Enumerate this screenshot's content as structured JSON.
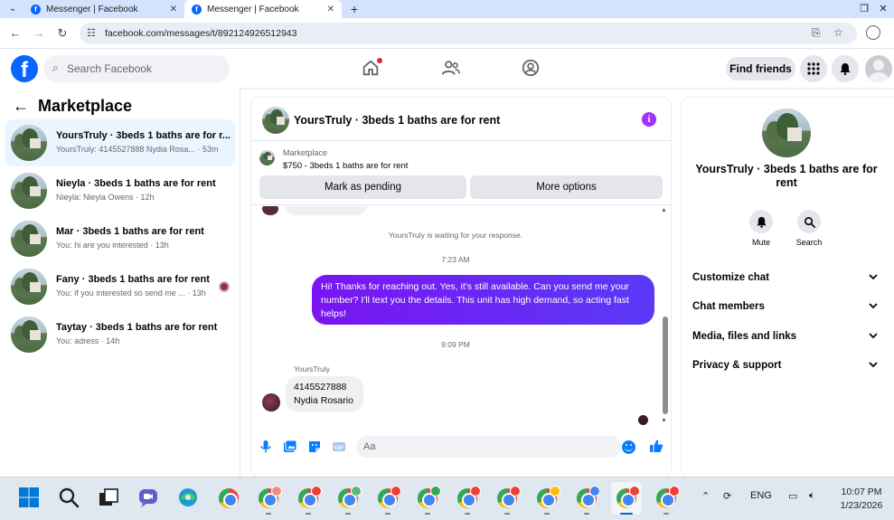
{
  "browser": {
    "tabs": [
      {
        "title": "Messenger | Facebook",
        "active": false
      },
      {
        "title": "Messenger | Facebook",
        "active": true
      }
    ],
    "url": "facebook.com/messages/t/892124926512943"
  },
  "header": {
    "search_placeholder": "Search Facebook",
    "find_friends_label": "Find friends"
  },
  "sidebar": {
    "title": "Marketplace",
    "conversations": [
      {
        "title": "YoursTruly · 3beds 1 baths are for r...",
        "preview": "YoursTruly: 4145527888 Nydia Rosa...",
        "time": "· 53m",
        "active": true
      },
      {
        "title": "Nieyla · 3beds 1 baths are for rent",
        "preview": "Nieyla: Nieyla Owens",
        "time": "· 12h",
        "active": false
      },
      {
        "title": "Mar · 3beds 1 baths are for rent",
        "preview": "You: hi are you interested",
        "time": "· 13h",
        "active": false
      },
      {
        "title": "Fany · 3beds 1 baths are for rent",
        "preview": "You: if you interested so send me ...",
        "time": "· 13h",
        "active": false
      },
      {
        "title": "Taytay · 3beds 1 baths are for rent",
        "preview": "You: adress",
        "time": "· 14h",
        "active": false
      }
    ]
  },
  "chat": {
    "title": "YoursTruly · 3beds 1 baths are for rent",
    "marketplace_label": "Marketplace",
    "listing": "$750 - 3beds 1 baths are for rent",
    "mark_pending_label": "Mark as pending",
    "more_options_label": "More options",
    "waiting_text": "YoursTruly is waiting for your response.",
    "time_1": "7:23 AM",
    "outgoing_message": "Hi! Thanks for reaching out. Yes, it's still available. Can you send me your number? I'll text you the details. This unit has high demand, so acting fast helps!",
    "time_2": "9:09 PM",
    "incoming_sender": "YoursTruly",
    "incoming_line1": "4145527888",
    "incoming_line2": "Nydia Rosario",
    "composer_placeholder": "Aa"
  },
  "details": {
    "title": "YoursTruly · 3beds 1 baths are for rent",
    "mute_label": "Mute",
    "search_label": "Search",
    "sections": [
      "Customize chat",
      "Chat members",
      "Media, files and links",
      "Privacy & support"
    ]
  },
  "taskbar": {
    "language": "ENG",
    "time": "10:07 PM",
    "date": "1/23/2026"
  },
  "colors": {
    "accent": "#0866ff",
    "outgoing_bubble": "#6e1ffb",
    "info": "#a033ff"
  }
}
